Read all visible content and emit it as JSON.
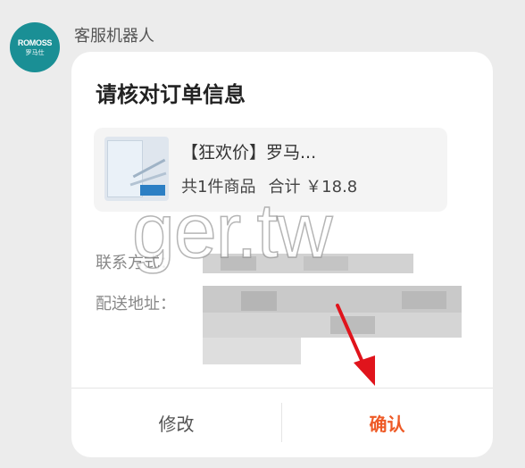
{
  "chat": {
    "sender_name": "客服机器人",
    "avatar": {
      "brand": "ROMOSS",
      "sub": "罗马仕"
    }
  },
  "card": {
    "title": "请核对订单信息",
    "product": {
      "name": "【狂欢价】罗马...",
      "count": "共1件商品",
      "total": "合计 ￥18.8"
    },
    "contact_label": "联系方式：",
    "address_label": "配送地址：",
    "buttons": {
      "modify": "修改",
      "confirm": "确认"
    }
  },
  "watermark": "ger.tw",
  "colors": {
    "accent": "#ee5a26",
    "avatar_bg": "#1a8f95",
    "annotation_arrow": "#e0141c"
  }
}
